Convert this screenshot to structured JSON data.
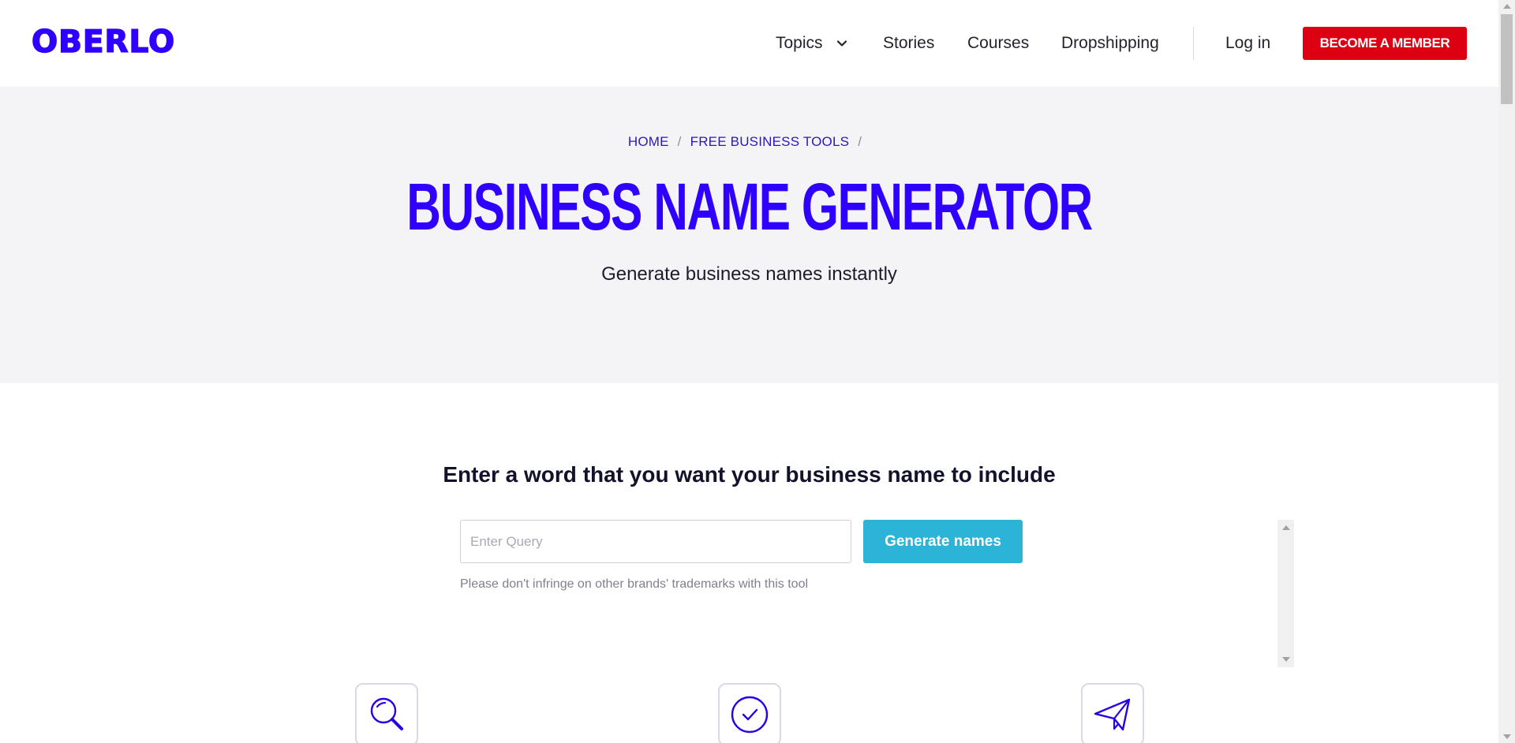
{
  "header": {
    "logo": "OBERLO",
    "nav": {
      "topics": "Topics",
      "stories": "Stories",
      "courses": "Courses",
      "dropshipping": "Dropshipping",
      "login": "Log in"
    },
    "cta": "BECOME A MEMBER"
  },
  "hero": {
    "breadcrumb": [
      "HOME",
      "FREE BUSINESS TOOLS"
    ],
    "breadcrumb_separator": "/",
    "title": "BUSINESS NAME GENERATOR",
    "subtitle": "Generate business names instantly"
  },
  "tool": {
    "heading": "Enter a word that you want your business name to include",
    "input_value": "",
    "input_placeholder": "Enter Query",
    "button_label": "Generate names",
    "disclaimer": "Please don't infringe on other brands' trademarks with this tool"
  },
  "features": [
    {
      "icon": "magnifier-icon"
    },
    {
      "icon": "check-circle-icon"
    },
    {
      "icon": "paper-plane-icon"
    }
  ],
  "colors": {
    "brand": "#2f00ff",
    "cta": "#dd0012",
    "generate_button": "#2bb4d8",
    "hero_bg": "#f4f4f6"
  }
}
